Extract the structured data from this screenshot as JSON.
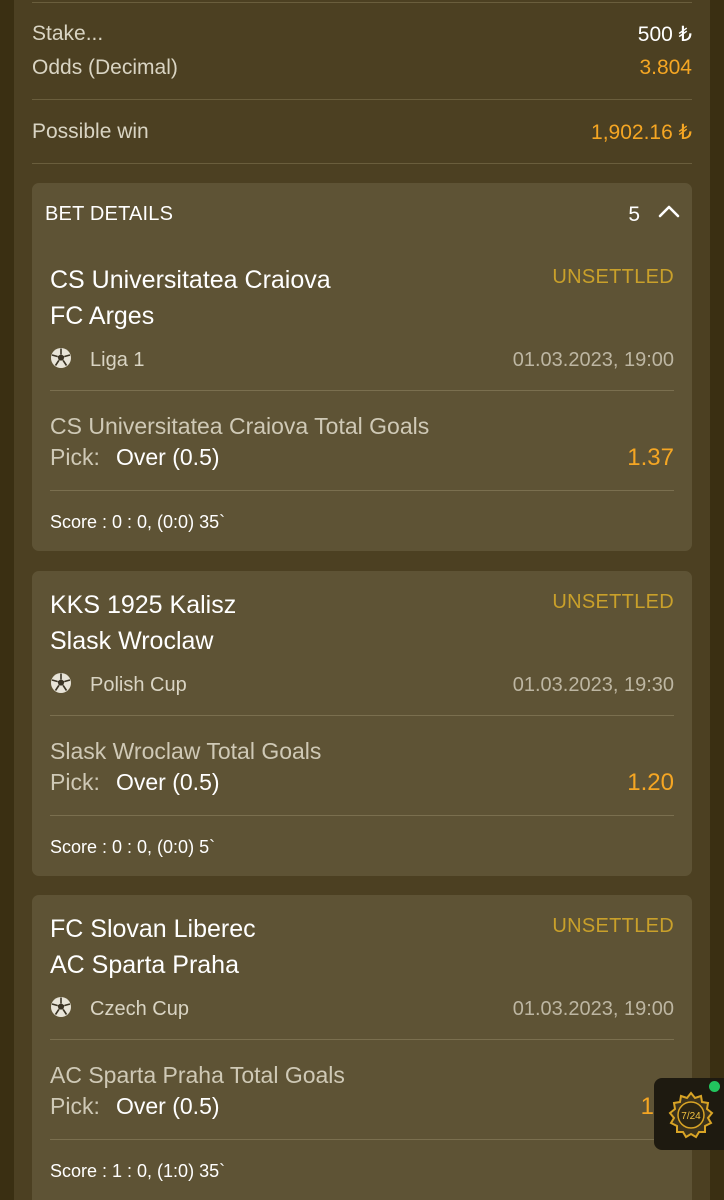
{
  "summary": {
    "stake_label": "Stake...",
    "stake_value": "500 ₺",
    "odds_label": "Odds (Decimal)",
    "odds_value": "3.804",
    "possible_win_label": "Possible win",
    "possible_win_value": "1,902.16 ₺"
  },
  "details": {
    "title": "BET DETAILS",
    "count": "5"
  },
  "pick_label": "Pick:",
  "bets": [
    {
      "team1": "CS Universitatea Craiova",
      "team2": "FC Arges",
      "status": "UNSETTLED",
      "league": "Liga 1",
      "datetime": "01.03.2023, 19:00",
      "market": "CS Universitatea Craiova Total Goals",
      "pick": "Over (0.5)",
      "odd": "1.37",
      "score": "Score : 0 : 0, (0:0) 35`"
    },
    {
      "team1": "KKS 1925 Kalisz",
      "team2": "Slask Wroclaw",
      "status": "UNSETTLED",
      "league": "Polish Cup",
      "datetime": "01.03.2023, 19:30",
      "market": "Slask Wroclaw Total Goals",
      "pick": "Over (0.5)",
      "odd": "1.20",
      "score": "Score : 0 : 0, (0:0) 5`"
    },
    {
      "team1": "FC Slovan Liberec",
      "team2": "AC Sparta Praha",
      "status": "UNSETTLED",
      "league": "Czech Cup",
      "datetime": "01.03.2023, 19:00",
      "market": "AC Sparta Praha Total Goals",
      "pick": "Over (0.5)",
      "odd": "1.2",
      "score": "Score : 1 : 0, (1:0) 35`"
    }
  ],
  "floating_badge": {
    "text": "7/24",
    "icon": "support-badge-icon"
  },
  "colors": {
    "accent_orange": "#f5a623",
    "status_gold": "#c9a02a",
    "card_bg": "#5e5335",
    "panel_bg": "#4c4022",
    "online_dot": "#22c55e"
  }
}
